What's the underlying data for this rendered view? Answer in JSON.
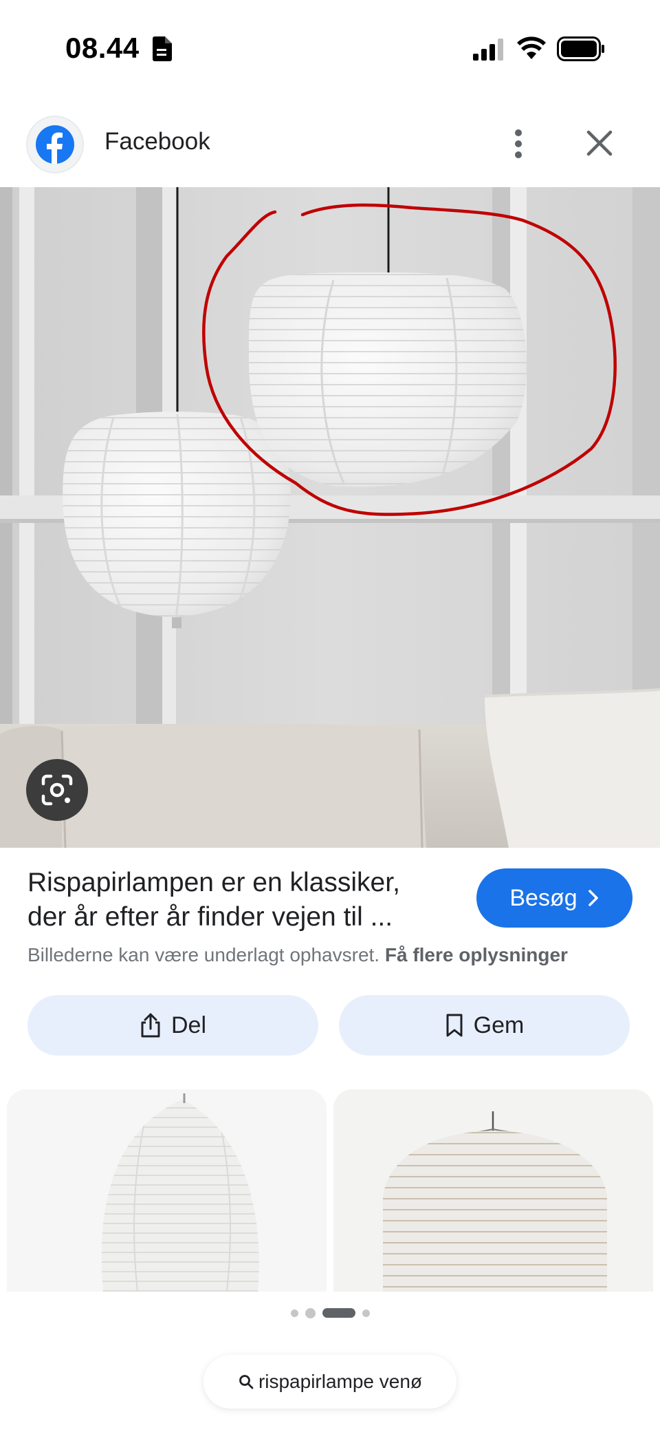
{
  "status_bar": {
    "time": "08.44",
    "icons": [
      "document-icon",
      "signal-icon",
      "wifi-icon",
      "battery-icon"
    ]
  },
  "header": {
    "source_icon": "facebook-logo-icon",
    "source_title": "Facebook",
    "more_icon": "more-vert-icon",
    "close_icon": "close-icon"
  },
  "main_image": {
    "description_icon": "google-lens-icon"
  },
  "info": {
    "title_line1": "Rispapirlampen er en klassiker,",
    "title_line2": "der år efter år finder vejen til ...",
    "visit_label": "Besøg",
    "copyright_text": "Billederne kan være underlagt ophavsret.",
    "copyright_link": "Få flere oplysninger"
  },
  "actions": {
    "share_label": "Del",
    "save_label": "Gem"
  },
  "pager": {
    "active_index": 2,
    "count": 4
  },
  "search": {
    "query": "rispapirlampe venø"
  },
  "colors": {
    "accent": "#1a73e8",
    "action_bg": "#e8effc",
    "annotation_red": "#c00000"
  }
}
